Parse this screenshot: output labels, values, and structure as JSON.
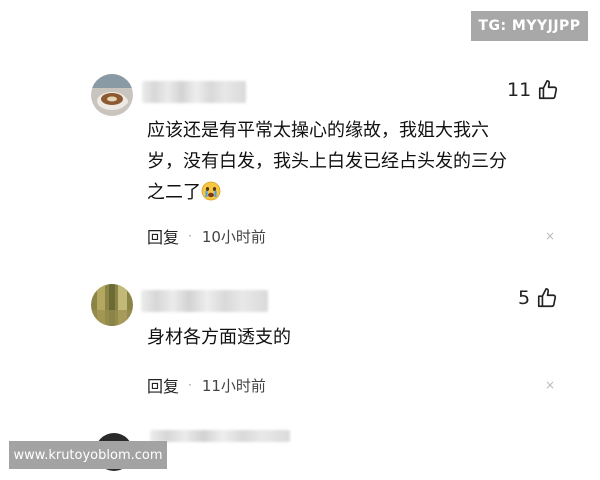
{
  "watermark_tg": "TG: MYYJJPP",
  "watermark_site": "www.krutoyoblom.com",
  "comments": [
    {
      "likes": "11",
      "text_line1": "应该还是有平常太操心的缘故，我姐大我六",
      "text_line2": "岁，没有白发，我头上白发已经占头发的三分",
      "text_line3": "之二了",
      "emoji": "crying-face-emoji",
      "reply_label": "回复",
      "separator": "·",
      "time": "10小时前",
      "close": "×"
    },
    {
      "likes": "5",
      "text_line1": "身材各方面透支的",
      "reply_label": "回复",
      "separator": "·",
      "time": "11小时前",
      "close": "×"
    }
  ],
  "colors": {
    "badge_bg": "#a8a8a8",
    "text": "#111111",
    "meta": "#444444"
  }
}
